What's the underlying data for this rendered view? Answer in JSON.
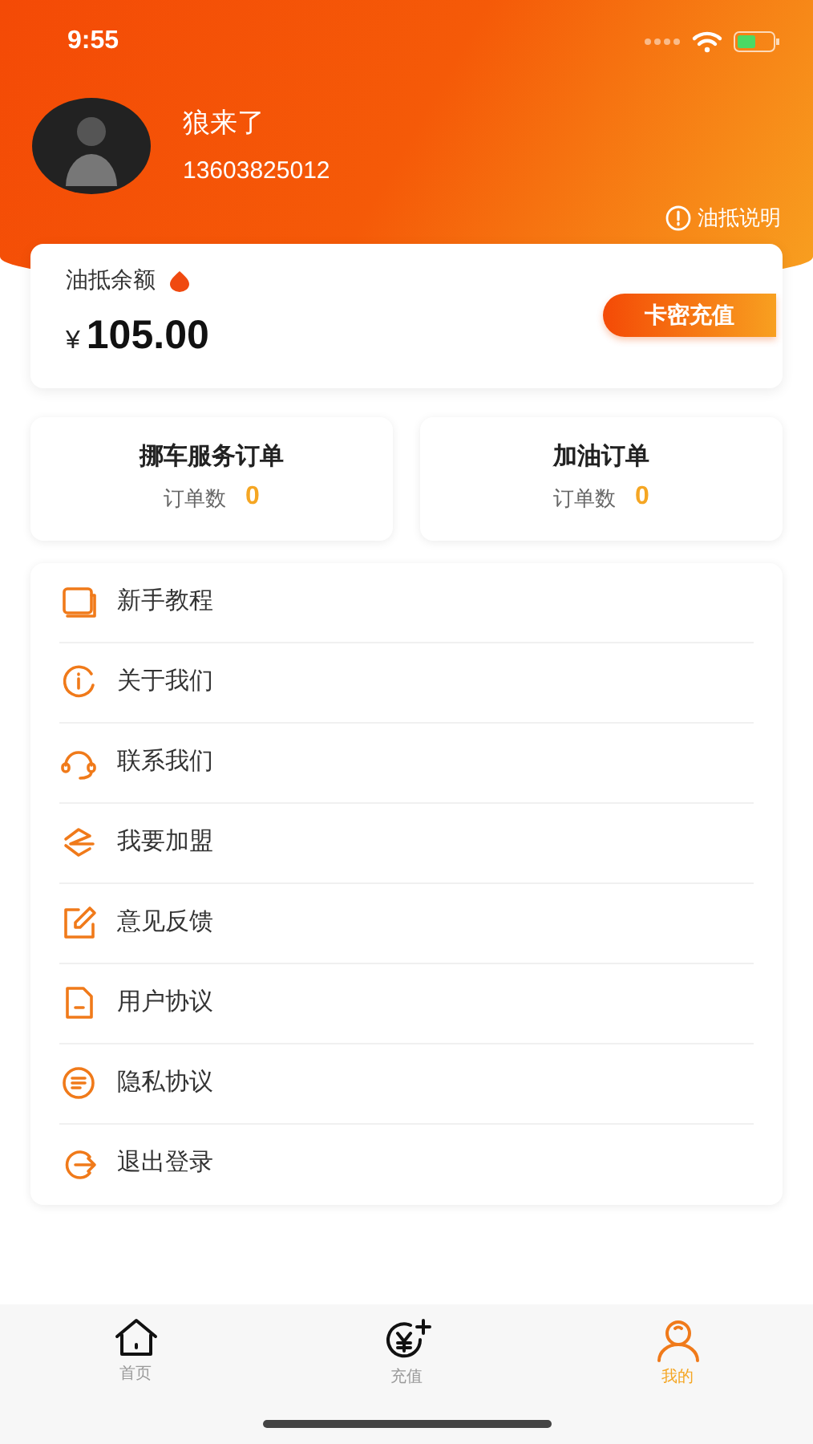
{
  "status_bar": {
    "time": "9:55"
  },
  "profile": {
    "name": "狼来了",
    "phone": "13603825012",
    "info_link": "油抵说明"
  },
  "balance": {
    "label": "油抵余额",
    "currency": "¥",
    "amount": "105.00",
    "button": "卡密充值"
  },
  "orders": [
    {
      "title": "挪车服务订单",
      "count_label": "订单数",
      "count": "0"
    },
    {
      "title": "加油订单",
      "count_label": "订单数",
      "count": "0"
    }
  ],
  "menu": [
    {
      "kind": "book",
      "label": "新手教程"
    },
    {
      "kind": "info",
      "label": "关于我们"
    },
    {
      "kind": "headset",
      "label": "联系我们"
    },
    {
      "kind": "join",
      "label": "我要加盟"
    },
    {
      "kind": "edit",
      "label": "意见反馈"
    },
    {
      "kind": "doc",
      "label": "用户协议"
    },
    {
      "kind": "privacy",
      "label": "隐私协议"
    },
    {
      "kind": "logout",
      "label": "退出登录"
    }
  ],
  "tab_bar": [
    {
      "kind": "home",
      "label": "首页",
      "selected": false
    },
    {
      "kind": "recharge",
      "label": "充值",
      "selected": false
    },
    {
      "kind": "me",
      "label": "我的",
      "selected": true
    }
  ]
}
